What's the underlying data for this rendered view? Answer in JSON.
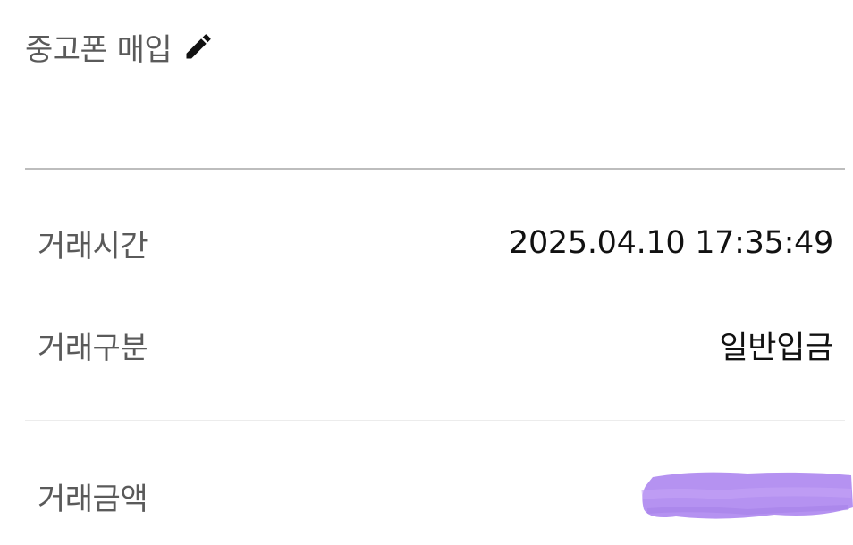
{
  "header": {
    "title": "중고폰 매입",
    "edit_icon": "pencil-icon"
  },
  "details": {
    "time_label": "거래시간",
    "time_value": "2025.04.10 17:35:49",
    "type_label": "거래구분",
    "type_value": "일반입금",
    "amount_label": "거래금액"
  },
  "colors": {
    "label": "#5a5a5a",
    "value": "#111111",
    "divider": "#bdbdbd",
    "redaction": "#b18cf0"
  }
}
